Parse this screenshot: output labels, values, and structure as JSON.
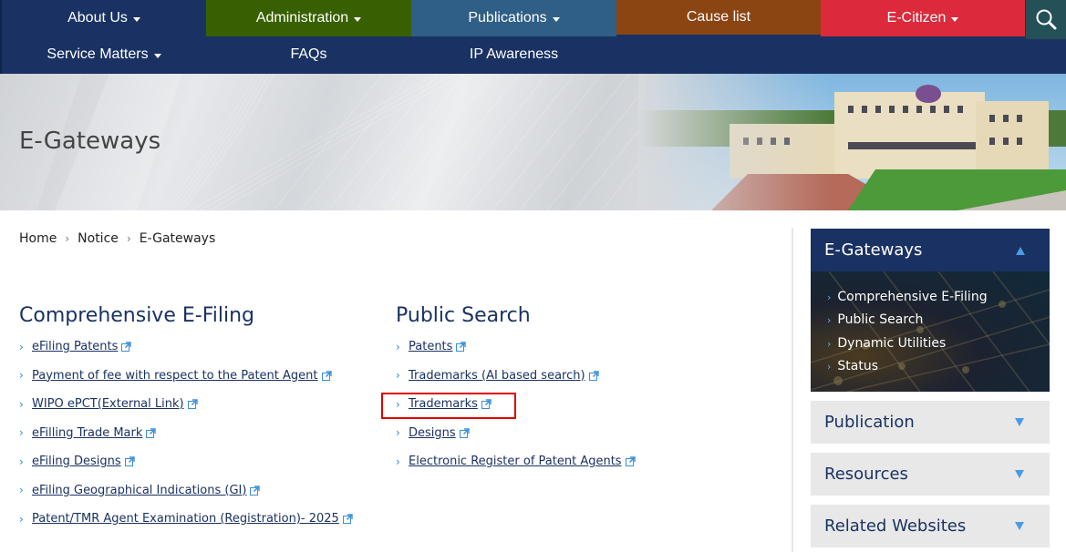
{
  "nav": {
    "row1": [
      {
        "label": "About Us",
        "dropdown": true,
        "color": "#1a3263"
      },
      {
        "label": "Administration",
        "dropdown": true,
        "color": "#386000"
      },
      {
        "label": "Publications",
        "dropdown": true,
        "color": "#2f5e86"
      },
      {
        "label": "Cause list",
        "dropdown": false,
        "color": "#8b4513"
      },
      {
        "label": "E-Citizen",
        "dropdown": true,
        "color": "#dc2a3c"
      }
    ],
    "row2": [
      {
        "label": "Service Matters",
        "dropdown": true
      },
      {
        "label": "FAQs",
        "dropdown": false
      },
      {
        "label": "IP Awareness",
        "dropdown": false
      }
    ],
    "search_icon": "search-icon"
  },
  "banner": {
    "title": "E-Gateways"
  },
  "breadcrumb": [
    "Home",
    "Notice",
    "E-Gateways"
  ],
  "sections": [
    {
      "title": "Comprehensive E-Filing",
      "links": [
        "eFiling Patents",
        "Payment of fee with respect to the Patent Agent",
        "WIPO ePCT(External Link)",
        "eFilling Trade Mark",
        "eFiling Designs",
        "eFiling Geographical Indications (GI)",
        "Patent/TMR Agent Examination (Registration)- 2025"
      ]
    },
    {
      "title": "Public Search",
      "links": [
        "Patents",
        "Trademarks (AI based search)",
        "Trademarks",
        "Designs",
        "Electronic Register of Patent Agents"
      ]
    }
  ],
  "sidebar": {
    "active": {
      "title": "E-Gateways",
      "items": [
        "Comprehensive E-Filing",
        "Public Search",
        "Dynamic Utilities",
        "Status"
      ]
    },
    "collapsed": [
      "Publication",
      "Resources",
      "Related Websites"
    ]
  },
  "colors": {
    "navy": "#1a3263",
    "accent_blue": "#4a9ae8",
    "highlight": "#e00000"
  }
}
